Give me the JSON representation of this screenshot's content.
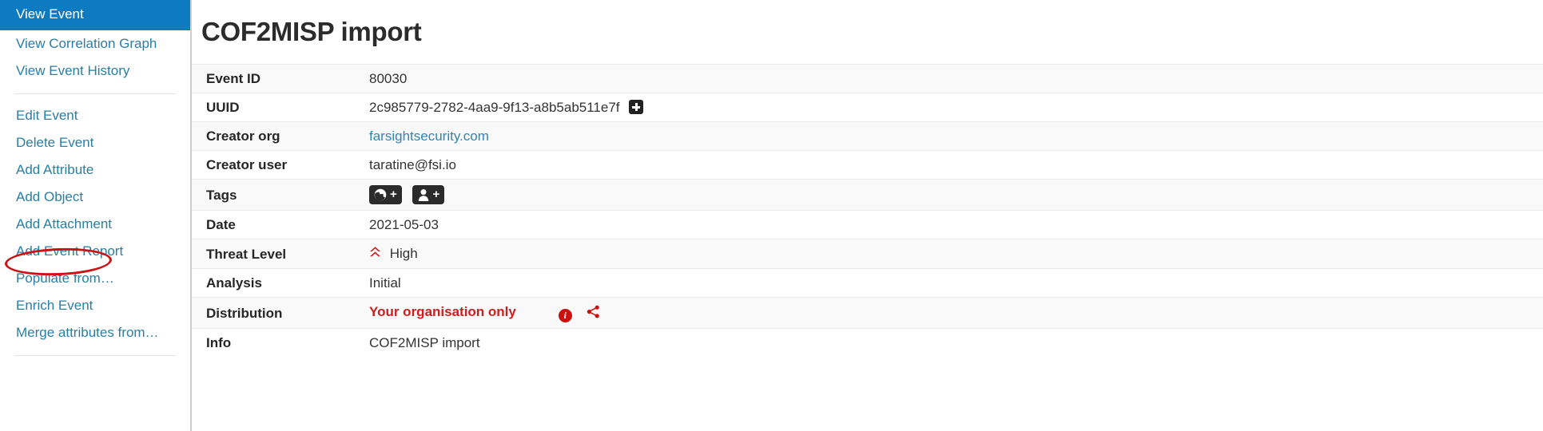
{
  "sidebar": {
    "items": [
      {
        "label": "View Event",
        "active": true,
        "name": "sidebar-item-view-event"
      },
      {
        "label": "View Correlation Graph",
        "active": false,
        "name": "sidebar-item-view-correlation-graph"
      },
      {
        "label": "View Event History",
        "active": false,
        "name": "sidebar-item-view-event-history"
      },
      {
        "label": "Edit Event",
        "active": false,
        "name": "sidebar-item-edit-event"
      },
      {
        "label": "Delete Event",
        "active": false,
        "name": "sidebar-item-delete-event"
      },
      {
        "label": "Add Attribute",
        "active": false,
        "name": "sidebar-item-add-attribute"
      },
      {
        "label": "Add Object",
        "active": false,
        "name": "sidebar-item-add-object"
      },
      {
        "label": "Add Attachment",
        "active": false,
        "name": "sidebar-item-add-attachment"
      },
      {
        "label": "Add Event Report",
        "active": false,
        "name": "sidebar-item-add-event-report"
      },
      {
        "label": "Populate from…",
        "active": false,
        "name": "sidebar-item-populate-from"
      },
      {
        "label": "Enrich Event",
        "active": false,
        "name": "sidebar-item-enrich-event"
      },
      {
        "label": "Merge attributes from…",
        "active": false,
        "name": "sidebar-item-merge-attributes-from"
      }
    ],
    "highlight_color": "#0e7ac0",
    "link_color": "#2a7ea3",
    "annotation_color": "#cc1111"
  },
  "main": {
    "title": "COF2MISP import",
    "rows": [
      {
        "key": "Event ID",
        "value": "80030",
        "type": "text"
      },
      {
        "key": "UUID",
        "value": "2c985779-2782-4aa9-9f13-a8b5ab511e7f",
        "type": "uuid"
      },
      {
        "key": "Creator org",
        "value": "farsightsecurity.com",
        "type": "link"
      },
      {
        "key": "Creator user",
        "value": "taratine@fsi.io",
        "type": "text"
      },
      {
        "key": "Tags",
        "value": "",
        "type": "tags"
      },
      {
        "key": "Date",
        "value": "2021-05-03",
        "type": "text"
      },
      {
        "key": "Threat Level",
        "value": "High",
        "type": "threat"
      },
      {
        "key": "Analysis",
        "value": "Initial",
        "type": "text"
      },
      {
        "key": "Distribution",
        "value": "Your organisation only",
        "type": "distribution"
      },
      {
        "key": "Info",
        "value": "COF2MISP import",
        "type": "text"
      }
    ],
    "icons": {
      "uuid_add": "plus-square-icon",
      "tag_global": "globe-add-tag-icon",
      "tag_local": "user-add-tag-icon",
      "threat_level": "chevron-double-up-icon",
      "distribution_info": "info-circle-icon",
      "distribution_share": "share-icon",
      "plus_glyph": "+",
      "info_glyph": "i"
    },
    "colors": {
      "threat_high": "#cc1f1f",
      "distribution": "#cc1f1f",
      "link": "#2f86b5"
    }
  }
}
